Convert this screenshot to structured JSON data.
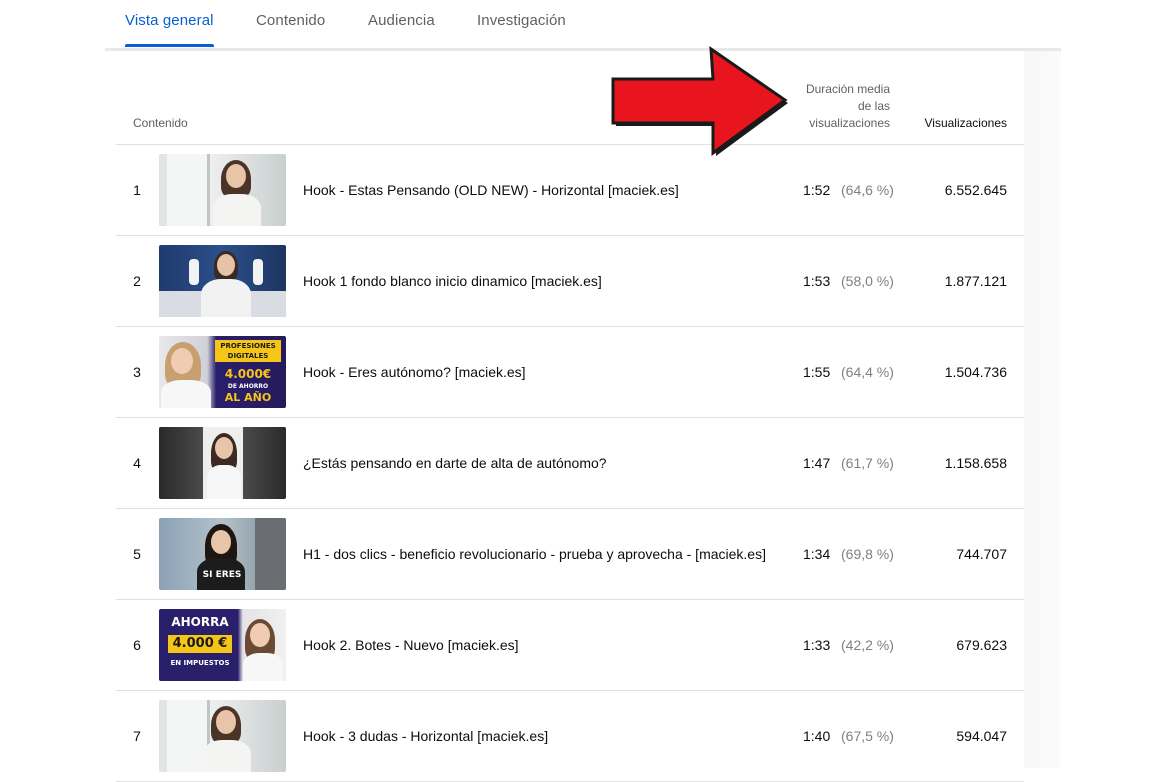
{
  "tabs": [
    {
      "label": "Vista general",
      "active": true
    },
    {
      "label": "Contenido",
      "active": false
    },
    {
      "label": "Audiencia",
      "active": false
    },
    {
      "label": "Investigación",
      "active": false
    }
  ],
  "table": {
    "header": {
      "content": "Contenido",
      "duration": [
        "Duración media",
        "de las",
        "visualizaciones"
      ],
      "views": "Visualizaciones"
    },
    "rows": [
      {
        "rank": "1",
        "title": "Hook - Estas Pensando (OLD NEW) - Horizontal [maciek.es]",
        "duration": "1:52",
        "percent": "(64,6 %)",
        "views": "6.552.645"
      },
      {
        "rank": "2",
        "title": "Hook 1 fondo blanco inicio dinamico [maciek.es]",
        "duration": "1:53",
        "percent": "(58,0 %)",
        "views": "1.877.121"
      },
      {
        "rank": "3",
        "title": "Hook - Eres autónomo? [maciek.es]",
        "duration": "1:55",
        "percent": "(64,4 %)",
        "views": "1.504.736",
        "thumb_text": [
          "PROFESIONES",
          "DIGITALES",
          "4.000€",
          "DE AHORRO",
          "AL AÑO"
        ]
      },
      {
        "rank": "4",
        "title": "¿Estás pensando en darte de alta de autónomo?",
        "duration": "1:47",
        "percent": "(61,7 %)",
        "views": "1.158.658"
      },
      {
        "rank": "5",
        "title": "H1 - dos clics - beneficio revolucionario - prueba y aprovecha - [maciek.es]",
        "duration": "1:34",
        "percent": "(69,8 %)",
        "views": "744.707",
        "thumb_text": [
          "SI ERES"
        ]
      },
      {
        "rank": "6",
        "title": "Hook 2. Botes - Nuevo [maciek.es]",
        "duration": "1:33",
        "percent": "(42,2 %)",
        "views": "679.623",
        "thumb_text": [
          "AHORRA",
          "4.000 €",
          "EN IMPUESTOS"
        ]
      },
      {
        "rank": "7",
        "title": "Hook - 3 dudas - Horizontal [maciek.es]",
        "duration": "1:40",
        "percent": "(67,5 %)",
        "views": "594.047"
      }
    ]
  },
  "colors": {
    "accent": "#065fd4",
    "arrow_fill": "#e8141e",
    "arrow_stroke": "#1a1a1a"
  }
}
